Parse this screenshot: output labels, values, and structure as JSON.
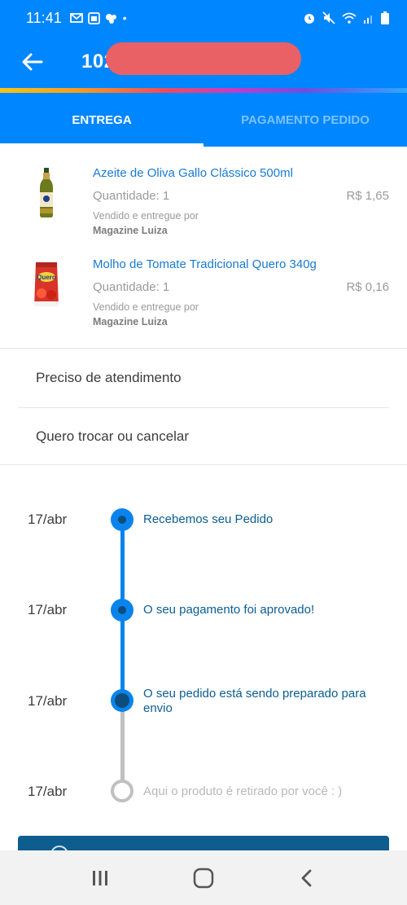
{
  "status_bar": {
    "time": "11:41",
    "dot": "•"
  },
  "header": {
    "order_number": "102"
  },
  "tabs": [
    {
      "label": "ENTREGA",
      "active": true
    },
    {
      "label": "PAGAMENTO PEDIDO",
      "active": false
    }
  ],
  "products": [
    {
      "name": "Azeite de Oliva Gallo Clássico 500ml",
      "quantity": "Quantidade: 1",
      "price": "R$ 1,65",
      "sold_by": "Vendido e entregue por",
      "seller": "Magazine Luiza"
    },
    {
      "name": "Molho de Tomate Tradicional Quero 340g",
      "quantity": "Quantidade: 1",
      "price": "R$ 0,16",
      "sold_by": "Vendido e entregue por",
      "seller": "Magazine Luiza"
    }
  ],
  "actions": [
    {
      "label": "Preciso de atendimento"
    },
    {
      "label": "Quero trocar ou cancelar"
    }
  ],
  "timeline": [
    {
      "date": "17/abr",
      "text": "Recebemos seu Pedido",
      "state": "done"
    },
    {
      "date": "17/abr",
      "text": "O seu pagamento foi aprovado!",
      "state": "done"
    },
    {
      "date": "17/abr",
      "text": "O seu pedido está sendo preparado para envio",
      "state": "current"
    },
    {
      "date": "17/abr",
      "text": "Aqui o produto é retirado por você : )",
      "state": "pending"
    }
  ],
  "colors": {
    "primary": "#0086ff",
    "link": "#1a7ad1",
    "timeline_active": "#0a84ec",
    "timeline_pending": "#c0c0c0",
    "redaction": "#ea6165"
  }
}
